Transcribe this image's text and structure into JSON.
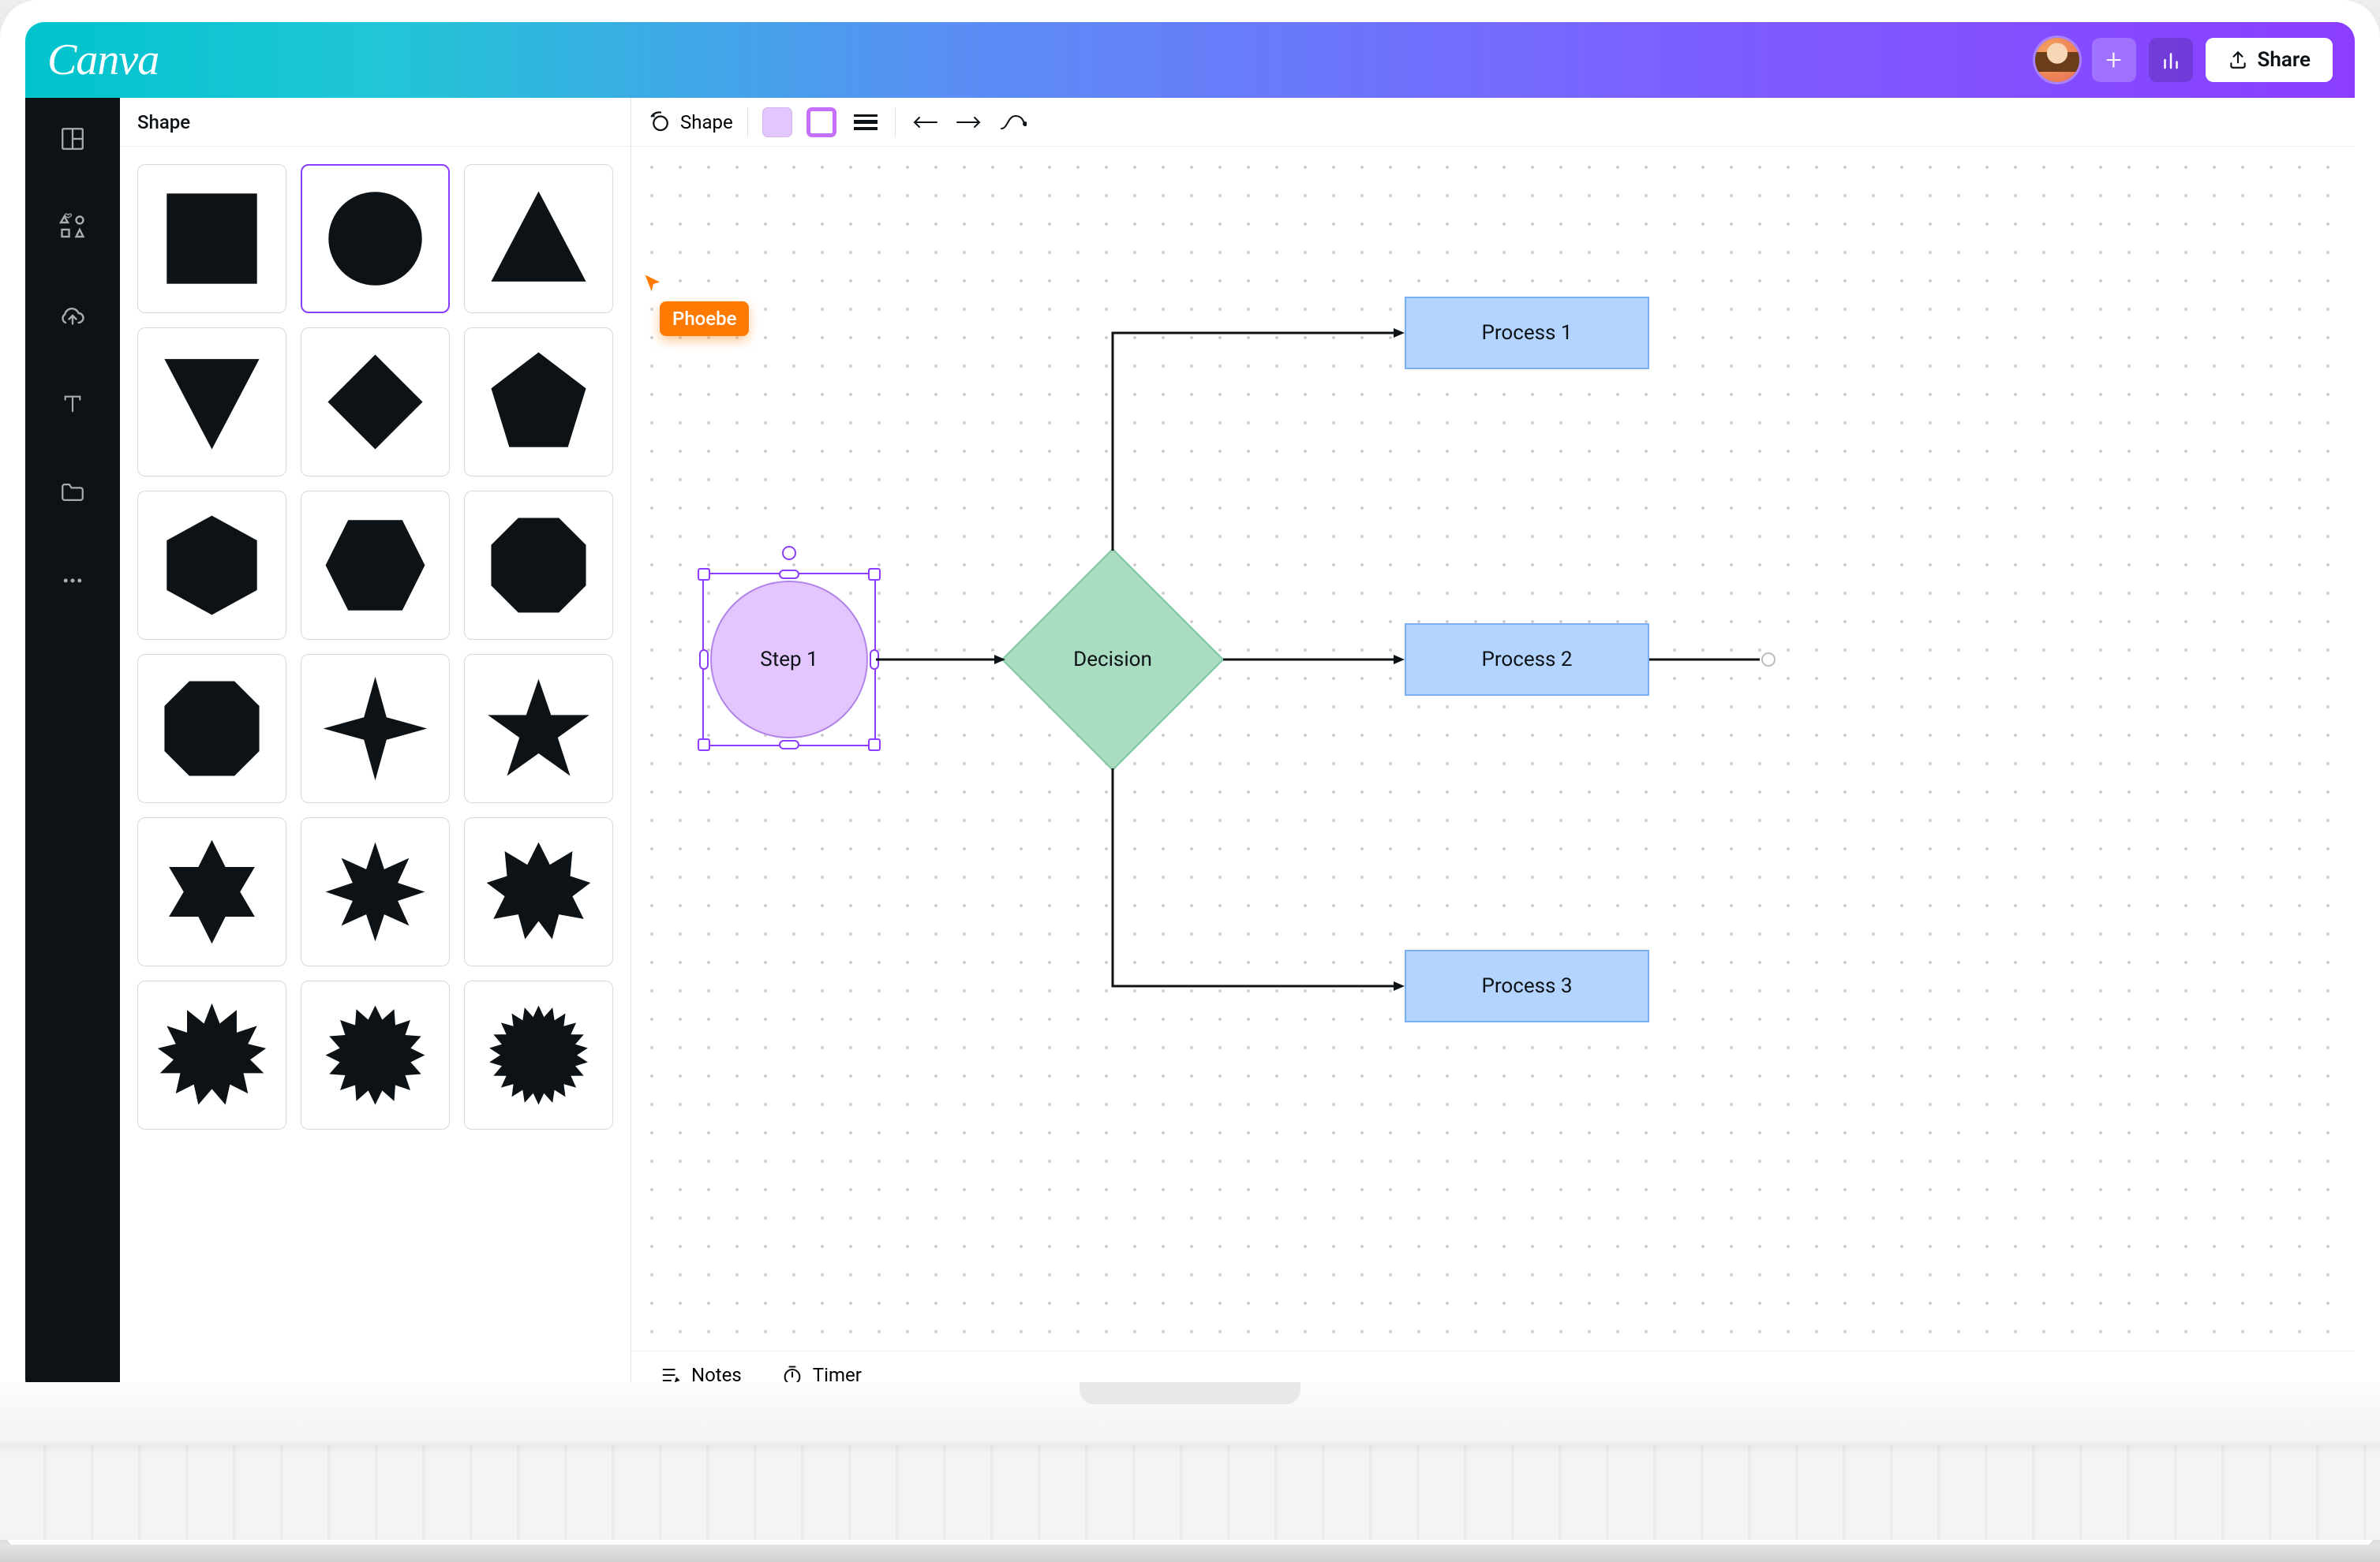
{
  "brand": "Canva",
  "topbar": {
    "share_label": "Share"
  },
  "panel": {
    "title": "Shape",
    "shapes": [
      "square",
      "circle",
      "triangle",
      "triangle-down",
      "diamond",
      "pentagon",
      "hexagon",
      "hexagon-rot",
      "octagon",
      "rounded-square",
      "star4",
      "star5",
      "star6",
      "star8",
      "burst9",
      "burst12",
      "burst16",
      "burst20"
    ],
    "selected_index": 1
  },
  "context_toolbar": {
    "shape_label": "Shape",
    "fill_color": "#e4c6ff",
    "border_color": "#c56fff"
  },
  "collaborator": {
    "name": "Phoebe",
    "color": "#ff7a00"
  },
  "flowchart": {
    "step1_label": "Step 1",
    "decision_label": "Decision",
    "process1_label": "Process 1",
    "process2_label": "Process 2",
    "process3_label": "Process 3"
  },
  "bottombar": {
    "notes_label": "Notes",
    "timer_label": "Timer"
  }
}
